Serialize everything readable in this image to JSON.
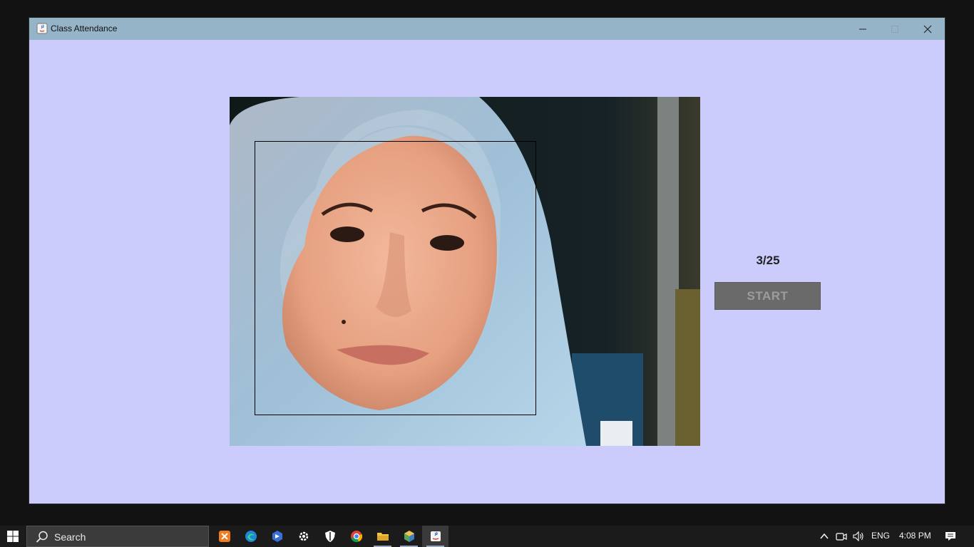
{
  "window": {
    "title": "Class Attendance",
    "background_color": "#ccccfc",
    "titlebar_color": "#96b4c8"
  },
  "attendance": {
    "counter": "3/25",
    "start_label": "START"
  },
  "camera": {
    "feed_icon": "webcam-feed",
    "face_detection": "face-bounding-box"
  },
  "taskbar": {
    "search_placeholder": "Search",
    "pinned_apps": [
      "xampp-icon",
      "edge-icon",
      "photos-icon",
      "settings-icon",
      "security-icon",
      "chrome-icon",
      "file-explorer-icon",
      "virtualbox-icon",
      "java-app-icon"
    ],
    "language": "ENG",
    "time": "4:08 PM"
  }
}
